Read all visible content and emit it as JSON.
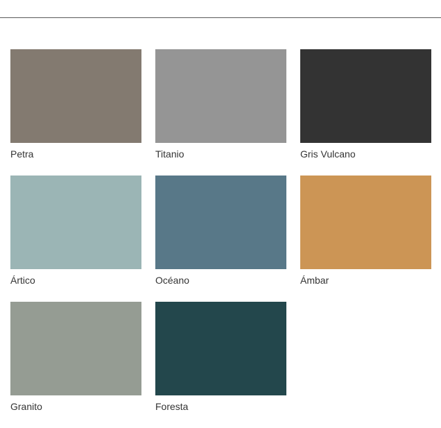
{
  "swatches": [
    {
      "name": "Petra",
      "color": "#837a70"
    },
    {
      "name": "Titanio",
      "color": "#959595"
    },
    {
      "name": "Gris Vulcano",
      "color": "#333333"
    },
    {
      "name": "Ártico",
      "color": "#9bb5b5"
    },
    {
      "name": "Océano",
      "color": "#587888"
    },
    {
      "name": "Ámbar",
      "color": "#cc9555"
    },
    {
      "name": "Granito",
      "color": "#959c93"
    },
    {
      "name": "Foresta",
      "color": "#23474c"
    }
  ]
}
